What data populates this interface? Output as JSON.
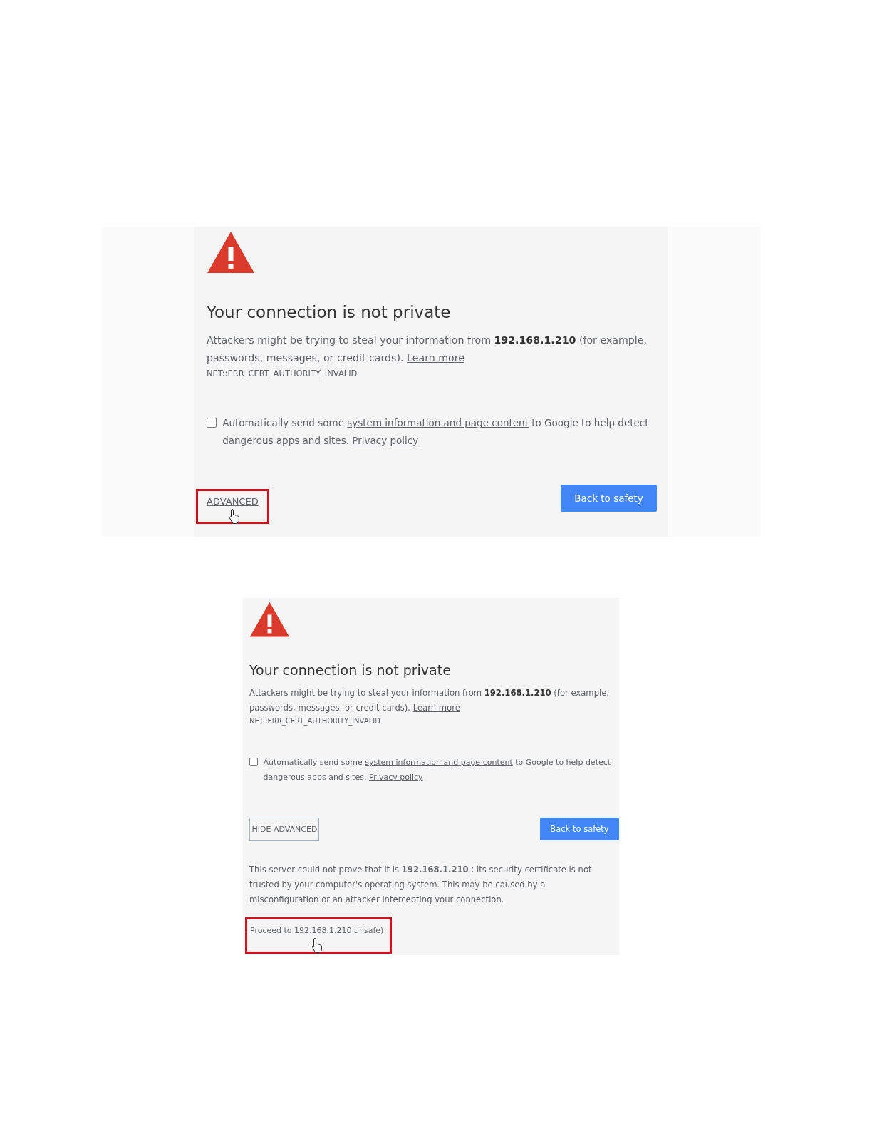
{
  "screenshots": [
    {
      "heading": "Your connection is not private",
      "body": "Attackers might be trying to steal your information from  **192.168.1.210**   (for example, passwords, messages, or credit cards).",
      "body_link": "Learn more",
      "error_code": "NET::ERR_CERT_AUTHORITY_INVALID",
      "report": {
        "checked": false,
        "text_before": "Automatically send some",
        "link": "system information and page content",
        "text_after": "to Google to help detect dangerous apps and sites.",
        "policy_link": "Privacy policy"
      },
      "toggle": {
        "kind": "link",
        "label": "ADVANCED",
        "highlighted": true
      },
      "back_button": "Back to safety"
    },
    {
      "heading": "Your connection is not private",
      "body": "Attackers might be trying to steal your information from  **192.168.1.210**   (for example, passwords, messages, or credit cards).",
      "body_link": "Learn more",
      "error_code": "NET::ERR_CERT_AUTHORITY_INVALID",
      "report": {
        "checked": false,
        "text_before": "Automatically send some",
        "link": "system information and page content",
        "text_after": "to Google to help detect dangerous apps and sites.",
        "policy_link": "Privacy policy"
      },
      "toggle": {
        "kind": "outlined",
        "label": "HIDE ADVANCED",
        "highlighted": false
      },
      "back_button": "Back to safety",
      "details": "This server could not prove that it is  **192.168.1.210**   ; its security certificate is not trusted by your computer's operating system. This may be caused by a misconfiguration or an attacker intercepting your connection.",
      "proceed": {
        "label": "Proceed to 192.168.1.210 unsafe)",
        "highlighted": true
      }
    }
  ]
}
